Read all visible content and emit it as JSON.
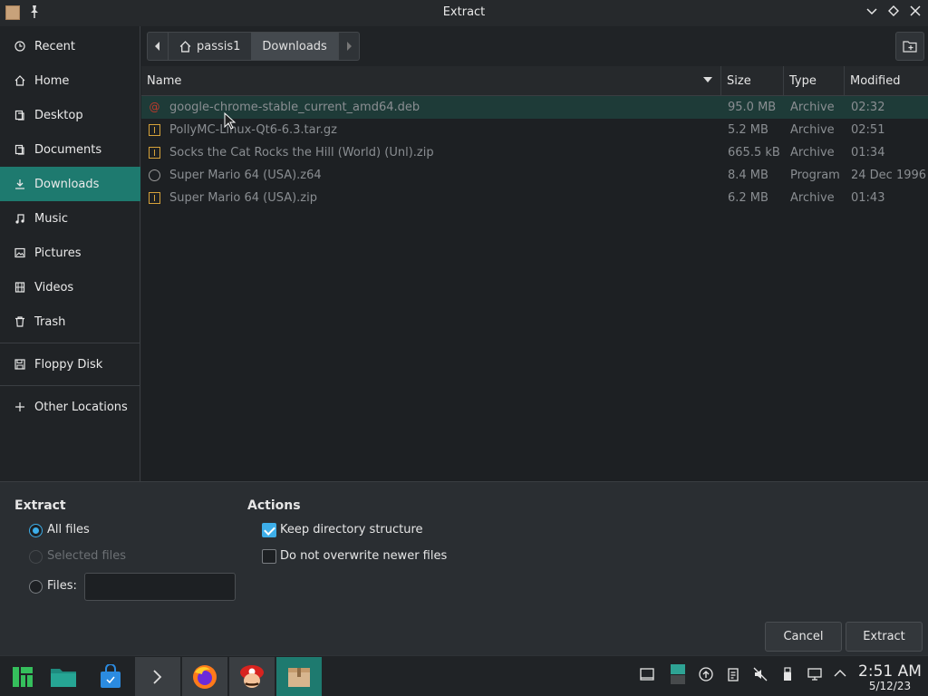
{
  "window": {
    "title": "Extract"
  },
  "sidebar": {
    "items": [
      {
        "label": "Recent",
        "icon": "clock-icon"
      },
      {
        "label": "Home",
        "icon": "home-icon"
      },
      {
        "label": "Desktop",
        "icon": "desktop-icon"
      },
      {
        "label": "Documents",
        "icon": "documents-icon"
      },
      {
        "label": "Downloads",
        "icon": "download-icon",
        "active": true
      },
      {
        "label": "Music",
        "icon": "music-icon"
      },
      {
        "label": "Pictures",
        "icon": "pictures-icon"
      },
      {
        "label": "Videos",
        "icon": "videos-icon"
      },
      {
        "label": "Trash",
        "icon": "trash-icon"
      },
      {
        "label": "Floppy Disk",
        "icon": "floppy-icon"
      },
      {
        "label": "Other Locations",
        "icon": "plus-icon"
      }
    ]
  },
  "pathbar": {
    "crumbs": [
      "passis1",
      "Downloads"
    ]
  },
  "filelist": {
    "columns": [
      "Name",
      "Size",
      "Type",
      "Modified"
    ],
    "rows": [
      {
        "name": "google-chrome-stable_current_amd64.deb",
        "size": "95.0 MB",
        "type": "Archive",
        "modified": "02:32",
        "icon": "debian-package-icon",
        "selected": true
      },
      {
        "name": "PollyMC-Linux-Qt6-6.3.tar.gz",
        "size": "5.2 MB",
        "type": "Archive",
        "modified": "02:51",
        "icon": "archive-icon"
      },
      {
        "name": "Socks the Cat Rocks the Hill (World) (Unl).zip",
        "size": "665.5 kB",
        "type": "Archive",
        "modified": "01:34",
        "icon": "archive-icon"
      },
      {
        "name": "Super Mario 64 (USA).z64",
        "size": "8.4 MB",
        "type": "Program",
        "modified": "24 Dec 1996",
        "icon": "program-icon"
      },
      {
        "name": "Super Mario 64 (USA).zip",
        "size": "6.2 MB",
        "type": "Archive",
        "modified": "01:43",
        "icon": "archive-icon"
      }
    ]
  },
  "options": {
    "extract_title": "Extract",
    "all_files": "All files",
    "selected_files": "Selected files",
    "files_label": "Files:",
    "files_value": "",
    "actions_title": "Actions",
    "keep_dir": "Keep directory structure",
    "no_overwrite": "Do not overwrite newer files"
  },
  "buttons": {
    "cancel": "Cancel",
    "extract": "Extract"
  },
  "taskbar": {
    "apps": [
      "manjaro-menu-icon",
      "file-manager-icon",
      "store-icon",
      "terminal-icon",
      "firefox-icon",
      "mario-icon",
      "ark-icon"
    ],
    "time": "2:51 AM",
    "date": "5/12/23"
  },
  "colors": {
    "accent": "#1e7a6f",
    "selection": "#3daee9"
  }
}
